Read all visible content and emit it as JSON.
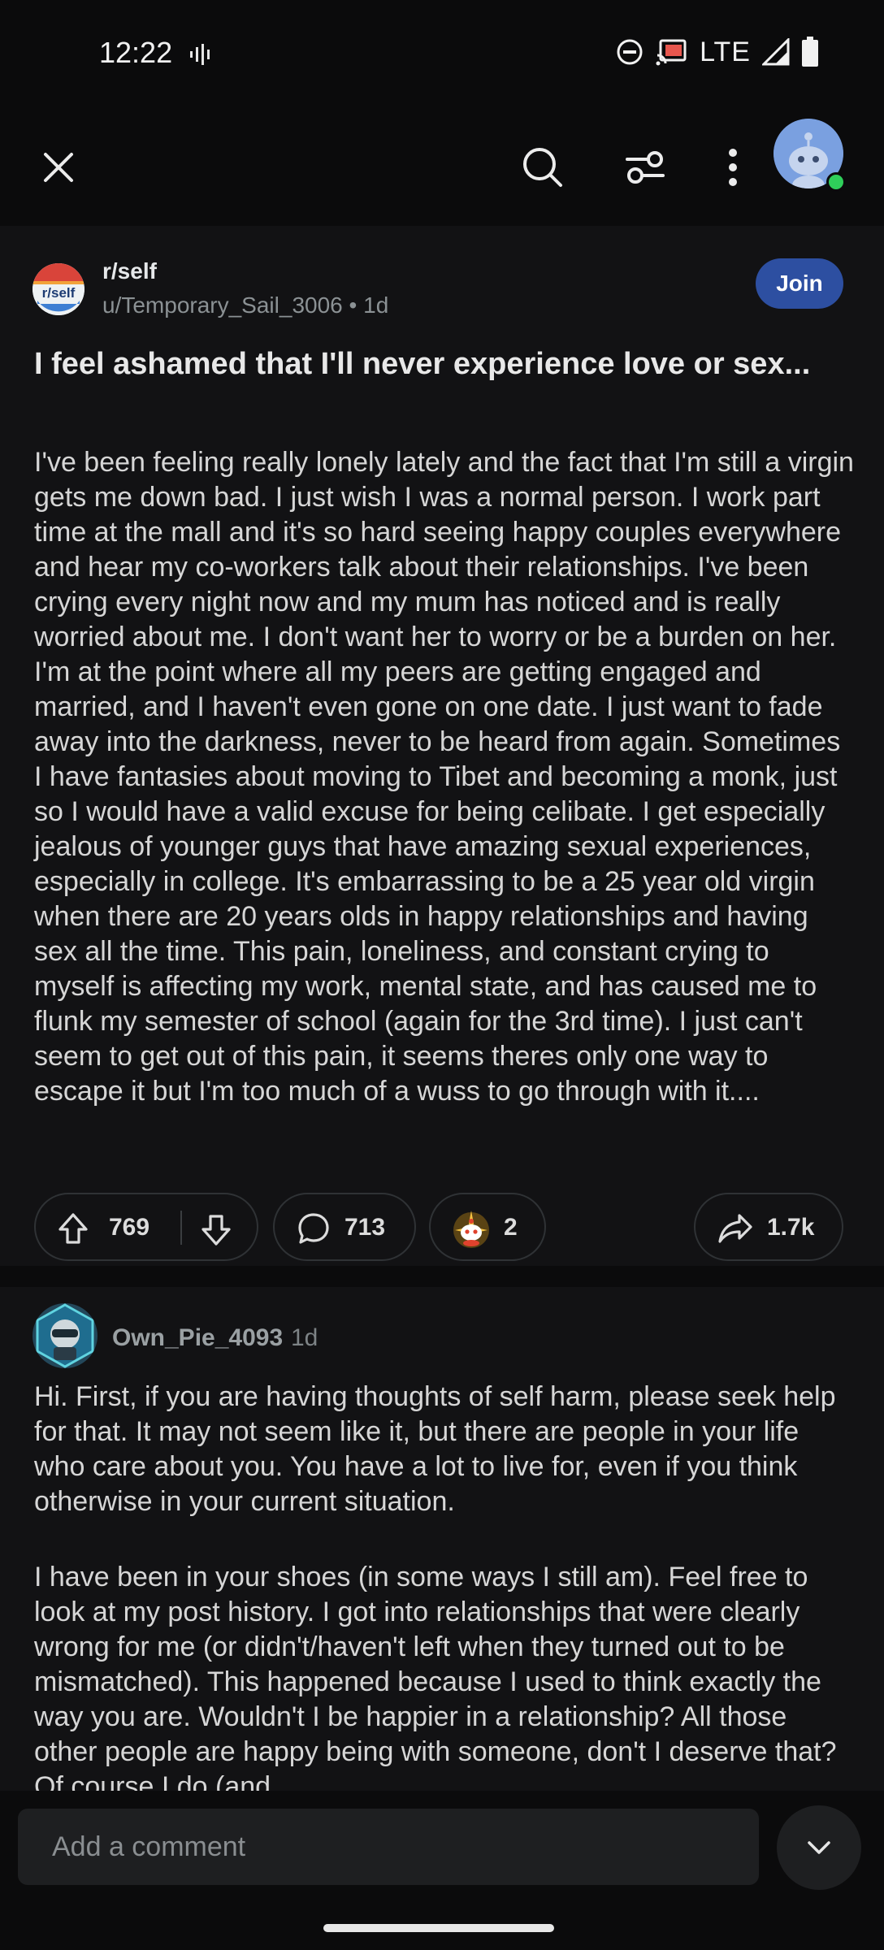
{
  "status_bar": {
    "time": "12:22",
    "network": "LTE"
  },
  "toolbar": {
    "icons": [
      "close-icon",
      "search-icon",
      "sort-icon",
      "more-icon",
      "profile-avatar"
    ]
  },
  "post": {
    "subreddit": "r/self",
    "subreddit_icon_text": "r/self",
    "author": "u/Temporary_Sail_3006",
    "age": "1d",
    "join_label": "Join",
    "title": "I feel ashamed that I'll never experience love or sex...",
    "body": "I've been feeling really lonely lately and the fact that I'm still a virgin gets me down bad. I just wish I was a normal person. I work part time at the mall and it's so hard seeing happy couples everywhere and hear my co-workers talk about their relationships. I've been crying every night now and my mum has noticed and is really worried about me. I don't want her to worry or be a burden on her. I'm at the point where all my peers are getting engaged and married, and I haven't even gone on one date. I just want to fade away into the darkness, never to be heard from again. Sometimes I have fantasies about moving to Tibet and becoming a monk, just so I would have a valid excuse for being celibate. I get especially jealous of younger guys that have amazing sexual experiences, especially in college. It's embarrassing to be a 25 year old virgin when there are 20 years olds in happy relationships and having sex all the time. This pain, loneliness, and constant crying to myself is affecting my work, mental state, and has caused me to flunk my semester of school (again for the 3rd time). I just can't seem to get out of this pain, it seems theres only one way to escape it but I'm too much of a wuss to go through with it....",
    "upvotes": "769",
    "comments": "713",
    "awards": "2",
    "shares": "1.7k"
  },
  "comment": {
    "author": "Own_Pie_4093",
    "age": "1d",
    "paragraphs": [
      "Hi. First, if you are having thoughts of self harm, please seek help for that. It may not seem like it, but there are people in your life who care about you. You have a lot to live for, even if you think otherwise in your current situation.",
      "I have been in your shoes (in some ways I still am). Feel free to look at my post history. I got into relationships that were clearly wrong for me (or didn't/haven't left when they turned out to be mismatched). This happened because I used to think exactly the way you are. Wouldn't I be happier in a relationship? All those other people are happy being with someone, don't I deserve that? Of course I do (and"
    ]
  },
  "composer": {
    "placeholder": "Add a comment"
  },
  "colors": {
    "background": "#0b0b0c",
    "card": "#121214",
    "join_button": "#2d4fa1",
    "online_dot": "#2fcf5a"
  }
}
